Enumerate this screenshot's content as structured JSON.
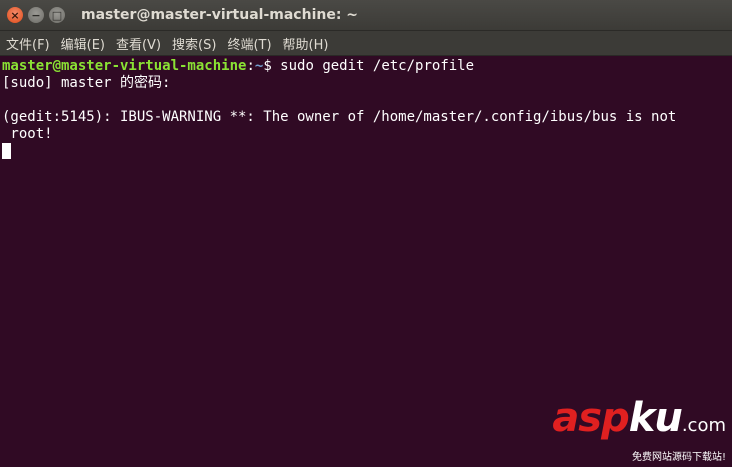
{
  "window": {
    "title": "master@master-virtual-machine: ~",
    "controls": {
      "close": "×",
      "minimize": "−",
      "maximize": "□"
    }
  },
  "menubar": {
    "items": [
      "文件(F)",
      "编辑(E)",
      "查看(V)",
      "搜索(S)",
      "终端(T)",
      "帮助(H)"
    ]
  },
  "terminal": {
    "prompt_user_host": "master@master-virtual-machine",
    "prompt_sep": ":",
    "prompt_path": "~",
    "prompt_dollar": "$ ",
    "command": "sudo gedit /etc/profile",
    "line2": "[sudo] master 的密码:",
    "line3": "",
    "line4": "(gedit:5145): IBUS-WARNING **: The owner of /home/master/.config/ibus/bus is not",
    "line5": " root!"
  },
  "watermark": {
    "logo_red": "asp",
    "logo_white": "ku",
    "logo_domain": ".com",
    "subtitle": "免费网站源码下载站!"
  },
  "colors": {
    "terminal_bg": "#300a24",
    "prompt_user": "#8ae234",
    "prompt_path": "#729fcf",
    "titlebar_bg": "#3c3b37",
    "close_button": "#df4a16"
  }
}
